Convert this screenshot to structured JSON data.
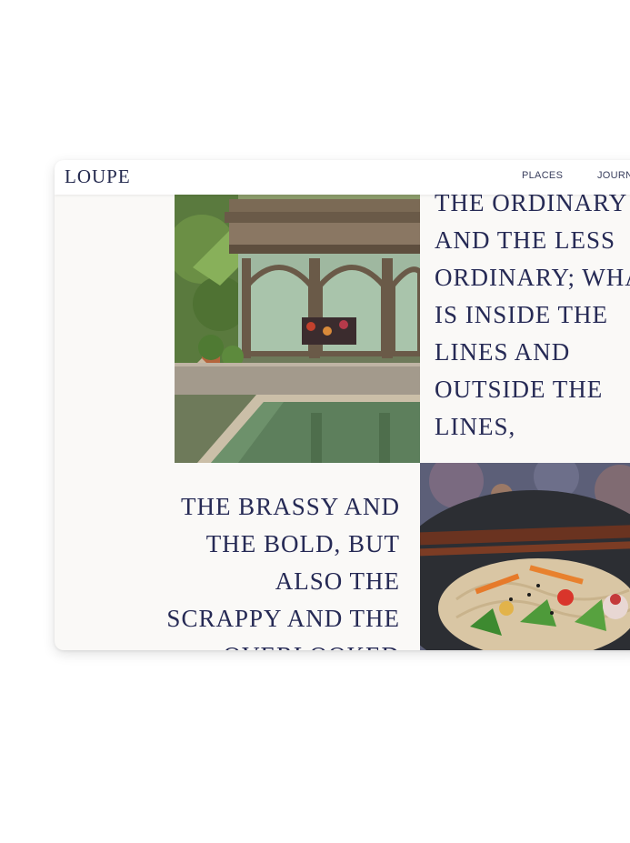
{
  "brand": {
    "logo_text": "LOUPE"
  },
  "nav": {
    "items": [
      "PLACES",
      "JOURNAL"
    ]
  },
  "main": {
    "quote_right": "THE ORDINARY\nAND THE LESS\nORDINARY; WHAT\nIS INSIDE THE\nLINES  AND\nOUTSIDE THE\nLINES,",
    "quote_left": "THE BRASSY AND\nTHE BOLD, BUT\nALSO THE\nSCRAPPY AND THE\nOVERLOOKED"
  },
  "colors": {
    "text": "#262a55",
    "background": "#faf9f7"
  },
  "icons": [
    "courtyard-photo",
    "food-photo"
  ]
}
